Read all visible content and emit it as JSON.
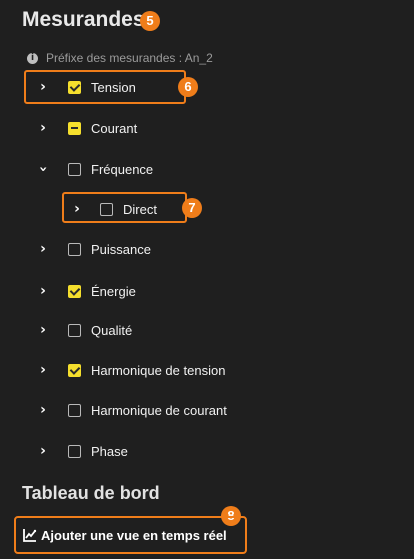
{
  "sections": {
    "measurands": {
      "title": "Mesurandes",
      "badge": "5",
      "prefix_text": "Préfixe des mesurandes : An_2"
    },
    "dashboard": {
      "title": "Tableau de bord",
      "badge": "8",
      "button_label": "Ajouter une vue en temps réel"
    }
  },
  "tree": [
    {
      "label": "Tension",
      "expanded": false,
      "state": "checked",
      "badge": "6"
    },
    {
      "label": "Courant",
      "expanded": false,
      "state": "partial"
    },
    {
      "label": "Fréquence",
      "expanded": true,
      "state": "unchecked"
    },
    {
      "label": "Direct",
      "expanded": false,
      "state": "unchecked",
      "badge": "7",
      "child": true
    },
    {
      "label": "Puissance",
      "expanded": false,
      "state": "unchecked"
    },
    {
      "label": "Énergie",
      "expanded": false,
      "state": "checked"
    },
    {
      "label": "Qualité",
      "expanded": false,
      "state": "unchecked"
    },
    {
      "label": "Harmonique de tension",
      "expanded": false,
      "state": "checked"
    },
    {
      "label": "Harmonique de courant",
      "expanded": false,
      "state": "unchecked"
    },
    {
      "label": "Phase",
      "expanded": false,
      "state": "unchecked"
    }
  ],
  "icons": {
    "info": "info-icon",
    "collapsed": "chevron-right-icon",
    "expanded": "chevron-down-icon",
    "graph": "chart-icon"
  },
  "colors": {
    "accent": "#ef7d1a",
    "checkbox_checked": "#f5df2d"
  }
}
